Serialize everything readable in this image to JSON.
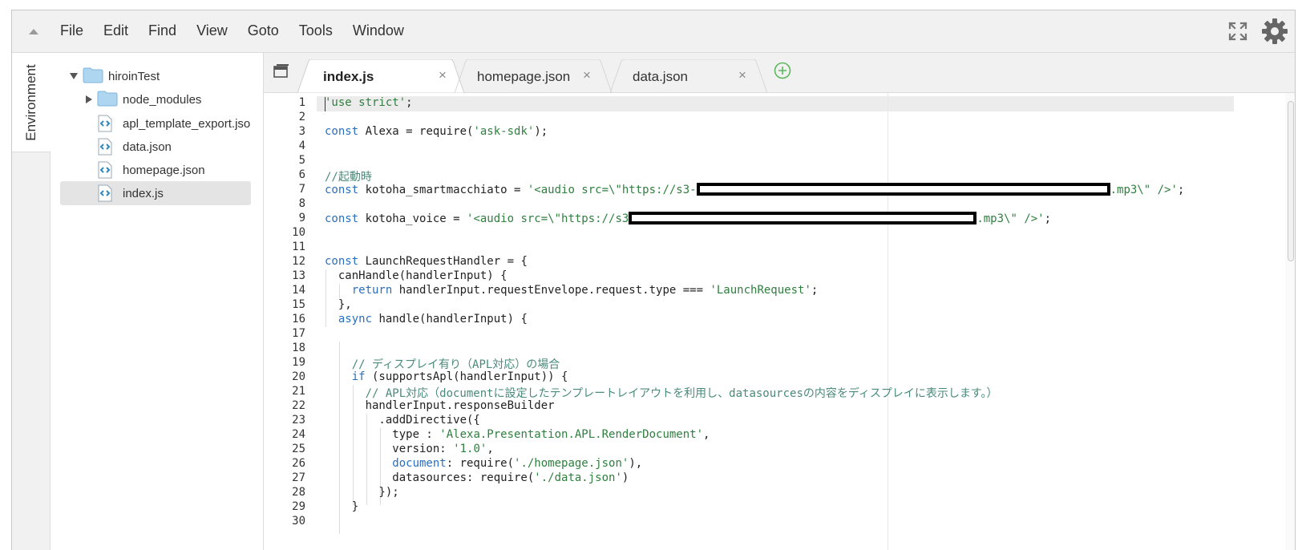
{
  "menu": {
    "items": [
      "File",
      "Edit",
      "Find",
      "View",
      "Goto",
      "Tools",
      "Window"
    ]
  },
  "icons": {
    "collapse": "collapse-up-triangle",
    "fullscreen": "fullscreen-expand",
    "settings": "gear"
  },
  "environment_tab": {
    "label": "Environment"
  },
  "file_tree": {
    "root": "hiroinTest",
    "items": [
      {
        "label": "node_modules",
        "type": "folder"
      },
      {
        "label": "apl_template_export.json",
        "type": "file"
      },
      {
        "label": "data.json",
        "type": "file"
      },
      {
        "label": "homepage.json",
        "type": "file"
      },
      {
        "label": "index.js",
        "type": "file",
        "selected": true
      }
    ]
  },
  "tabs": [
    {
      "label": "index.js",
      "active": true
    },
    {
      "label": "homepage.json",
      "active": false
    },
    {
      "label": "data.json",
      "active": false
    }
  ],
  "close_glyph": "×",
  "code": {
    "line_numbers": [
      "1",
      "2",
      "3",
      "4",
      "5",
      "6",
      "7",
      "8",
      "9",
      "10",
      "11",
      "12",
      "13",
      "14",
      "15",
      "16",
      "17",
      "18",
      "19",
      "20",
      "21",
      "22",
      "23",
      "24",
      "25",
      "26",
      "27",
      "28",
      "29",
      "30"
    ],
    "l1_str": "'use strict'",
    "l1_semi": ";",
    "l3_kw": "const",
    "l3_rest": " Alexa = require(",
    "l3_str": "'ask-sdk'",
    "l3_end": ");",
    "l6_cm": "//起動時",
    "l7_kw": "const",
    "l7_rest": " kotoha_smartmacchiato = ",
    "l7_str1": "'<audio src=\\\"https://s3-",
    "l7_str2": ".mp3\\\" />'",
    "l7_end": ";",
    "l9_kw": "const",
    "l9_rest": " kotoha_voice = ",
    "l9_str1": "'<audio src=\\\"https://s3",
    "l9_str2": ".mp3\\\" />'",
    "l9_end": ";",
    "l12_kw": "const",
    "l12_rest": " LaunchRequestHandler = {",
    "l13": "  canHandle(handlerInput) {",
    "l14_kw": "    return",
    "l14_rest": " handlerInput.requestEnvelope.request.type === ",
    "l14_str": "'LaunchRequest'",
    "l14_end": ";",
    "l15": "  },",
    "l16_kw": "  async",
    "l16_rest": " handle(handlerInput) {",
    "l19_cm": "    // ディスプレイ有り（APL対応）の場合",
    "l20_kw": "    if",
    "l20_rest": " (supportsApl(handlerInput)) {",
    "l21_cm": "      // APL対応（documentに設定したテンプレートレイアウトを利用し、datasourcesの内容をディスプレイに表示します。）",
    "l22": "      handlerInput.responseBuilder",
    "l23": "        .addDirective({",
    "l24_rest": "          type : ",
    "l24_str": "'Alexa.Presentation.APL.RenderDocument'",
    "l24_end": ",",
    "l25_rest": "          version: ",
    "l25_str": "'1.0'",
    "l25_end": ",",
    "l26_kw": "          document",
    "l26_rest": ": require(",
    "l26_str": "'./homepage.json'",
    "l26_end": "),",
    "l27_rest": "          datasources: require(",
    "l27_str": "'./data.json'",
    "l27_end": ")",
    "l28": "        });",
    "l29": "    }"
  }
}
